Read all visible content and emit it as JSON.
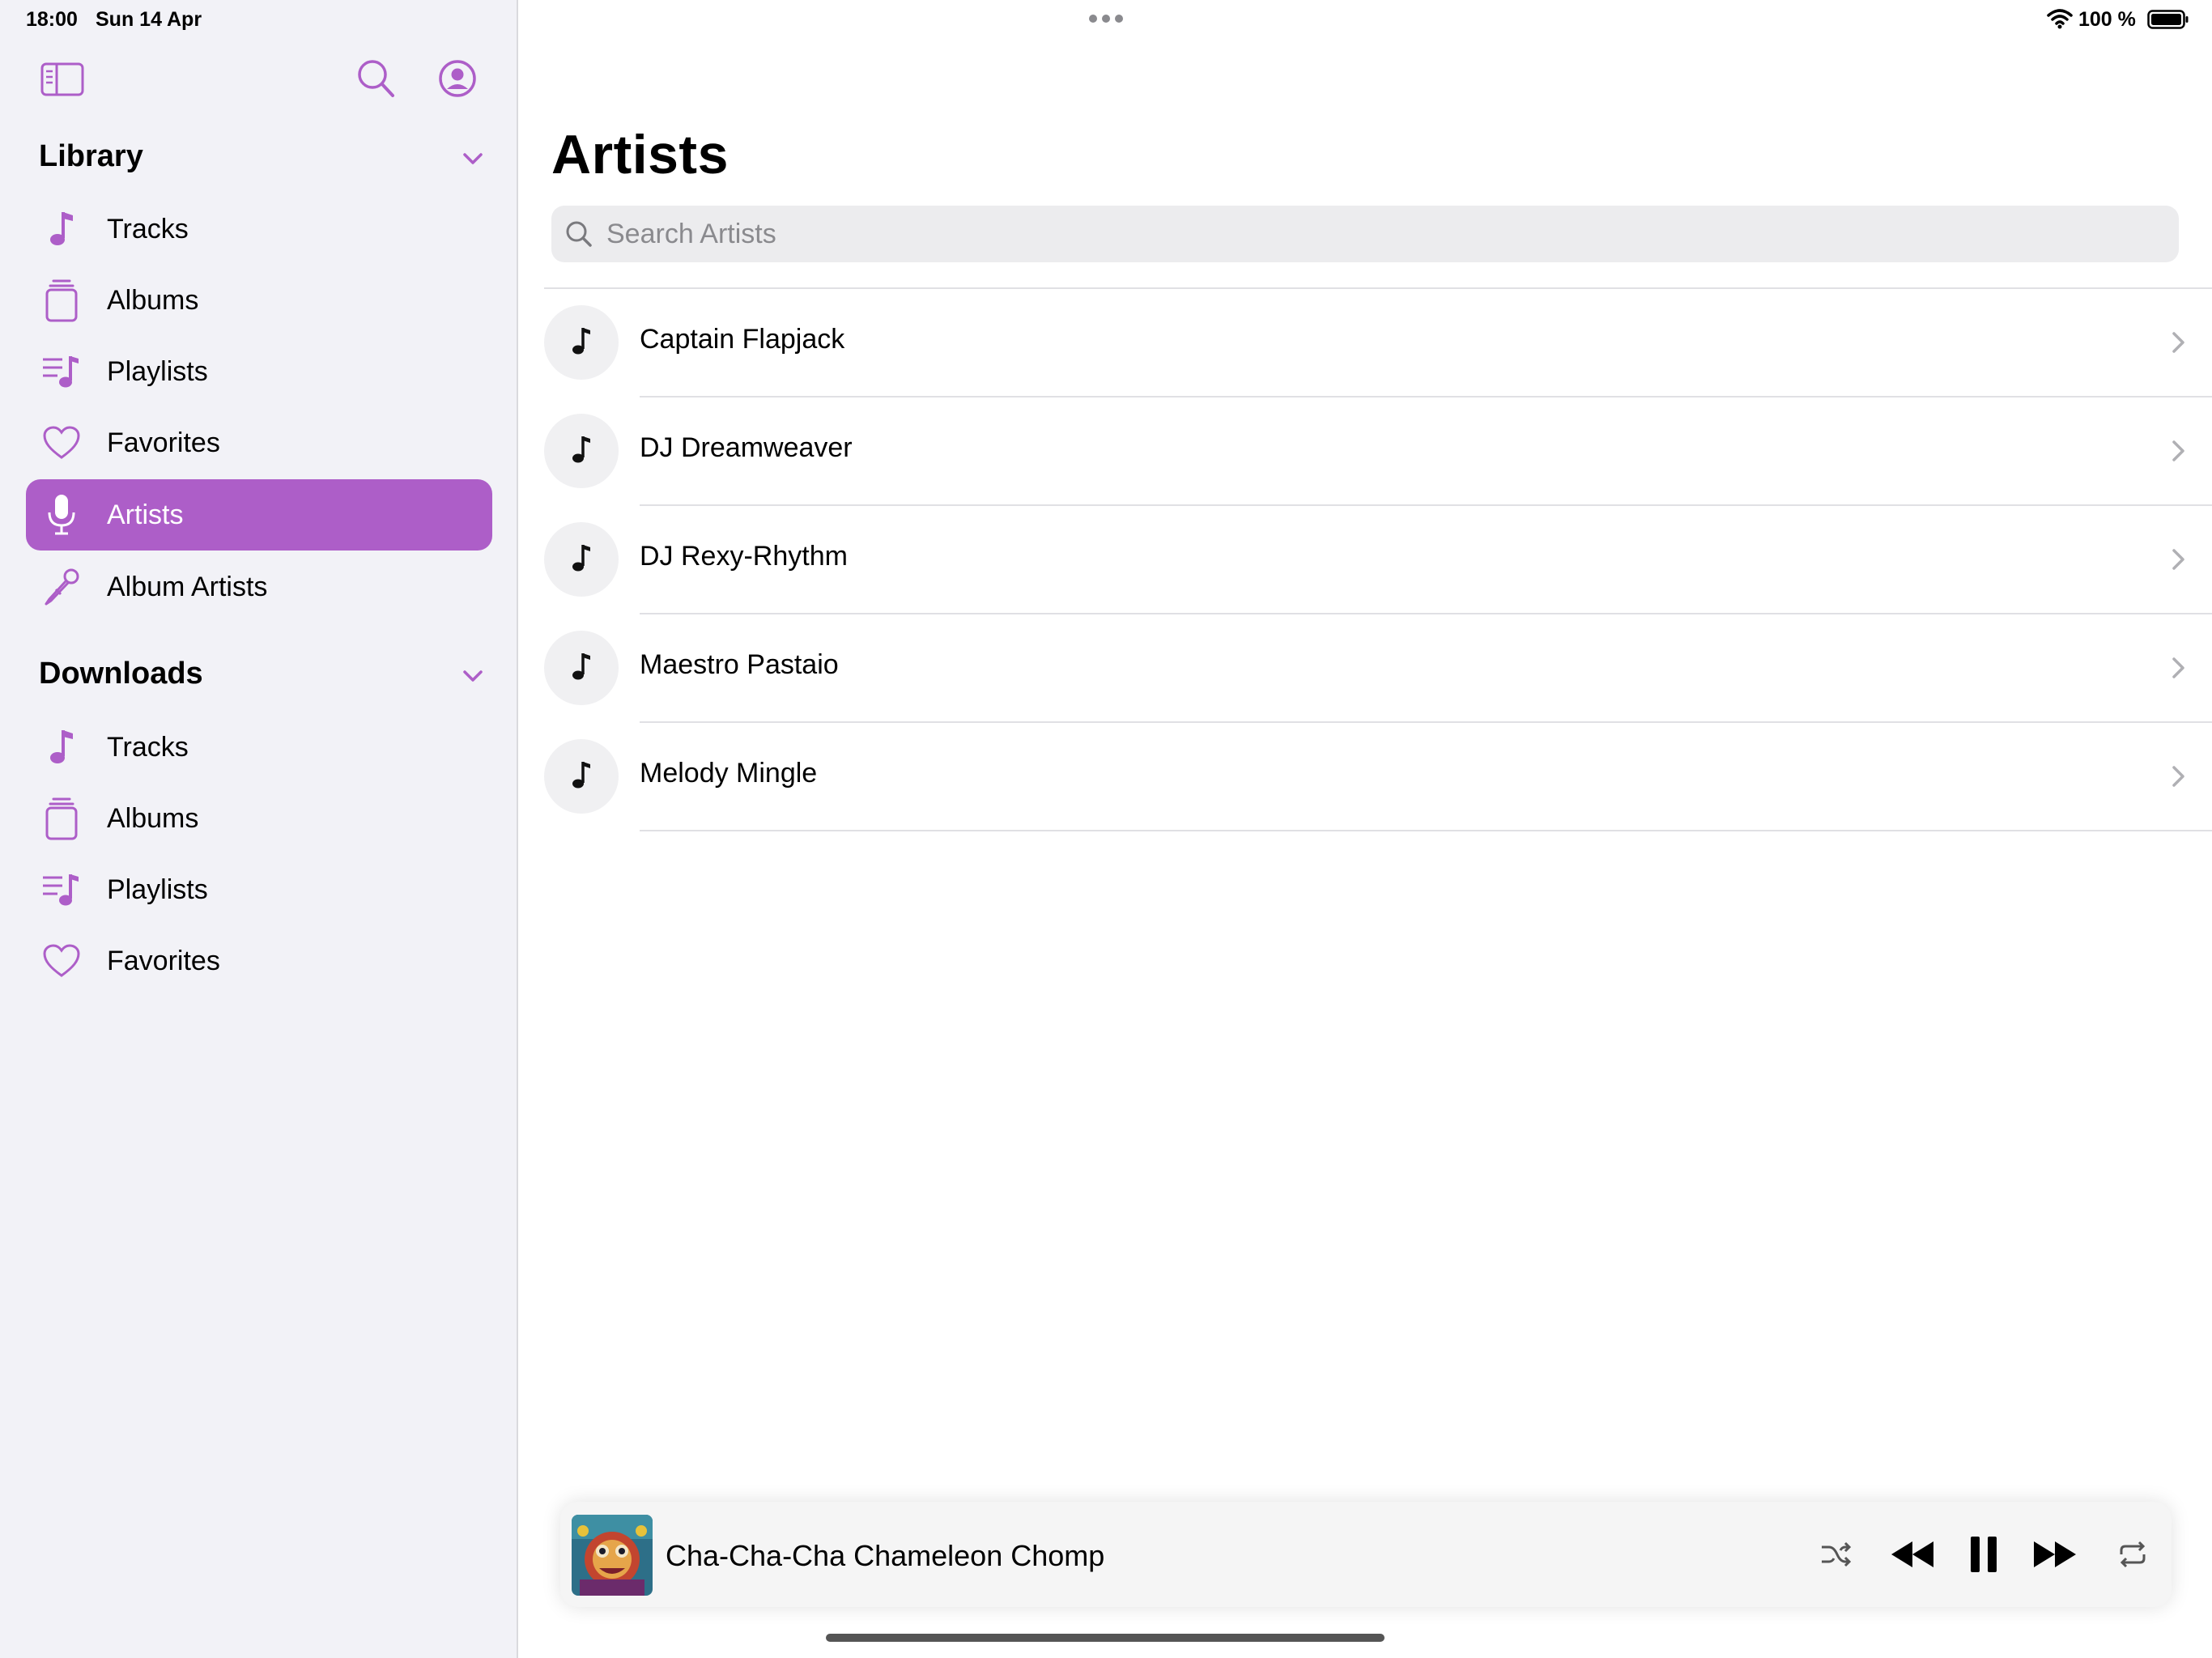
{
  "status_bar": {
    "time": "18:00",
    "date": "Sun 14 Apr",
    "battery_percent": "100 %"
  },
  "colors": {
    "accent": "#ad5ec8",
    "sidebar_bg": "#f2f2f7"
  },
  "sidebar": {
    "library": {
      "title": "Library",
      "items": [
        {
          "label": "Tracks",
          "icon": "music-note-icon"
        },
        {
          "label": "Albums",
          "icon": "album-stack-icon"
        },
        {
          "label": "Playlists",
          "icon": "playlist-icon"
        },
        {
          "label": "Favorites",
          "icon": "heart-icon"
        },
        {
          "label": "Artists",
          "icon": "microphone-icon",
          "selected": true
        },
        {
          "label": "Album Artists",
          "icon": "mic-pen-icon"
        }
      ]
    },
    "downloads": {
      "title": "Downloads",
      "items": [
        {
          "label": "Tracks",
          "icon": "music-note-icon"
        },
        {
          "label": "Albums",
          "icon": "album-stack-icon"
        },
        {
          "label": "Playlists",
          "icon": "playlist-icon"
        },
        {
          "label": "Favorites",
          "icon": "heart-icon"
        }
      ]
    }
  },
  "main": {
    "title": "Artists",
    "search": {
      "placeholder": "Search Artists",
      "value": ""
    },
    "artists": [
      {
        "name": "Captain Flapjack"
      },
      {
        "name": "DJ Dreamweaver"
      },
      {
        "name": "DJ Rexy-Rhythm"
      },
      {
        "name": "Maestro Pastaio"
      },
      {
        "name": "Melody Mingle"
      }
    ]
  },
  "player": {
    "track_title": "Cha-Cha-Cha Chameleon Chomp",
    "state": "playing"
  }
}
